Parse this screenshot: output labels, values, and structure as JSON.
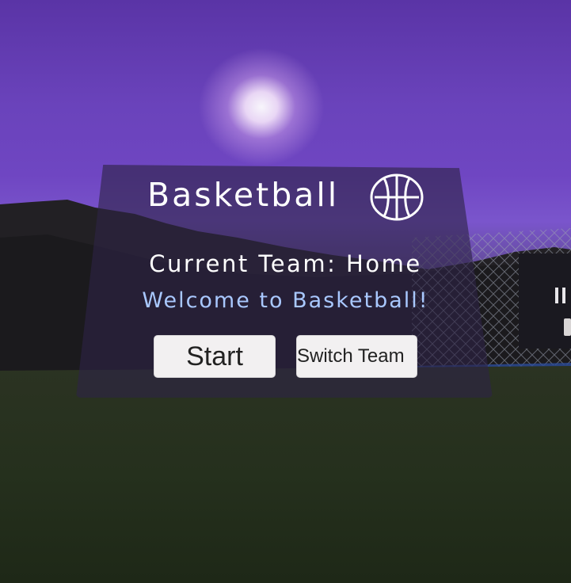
{
  "game": {
    "title": "Basketball",
    "current_team_label": "Current Team: Home",
    "welcome_message": "Welcome to Basketball!"
  },
  "buttons": {
    "start_label": "Start",
    "switch_team_label": "Switch Team"
  },
  "icons": {
    "title_icon": "basketball-icon",
    "hud_icon": "pause-icon"
  },
  "colors": {
    "title_text": "#ffffff",
    "welcome_text": "#a9c8ff",
    "button_bg": "#f2f0f1",
    "sky": "#6a43bb",
    "ground": "#25301d"
  }
}
